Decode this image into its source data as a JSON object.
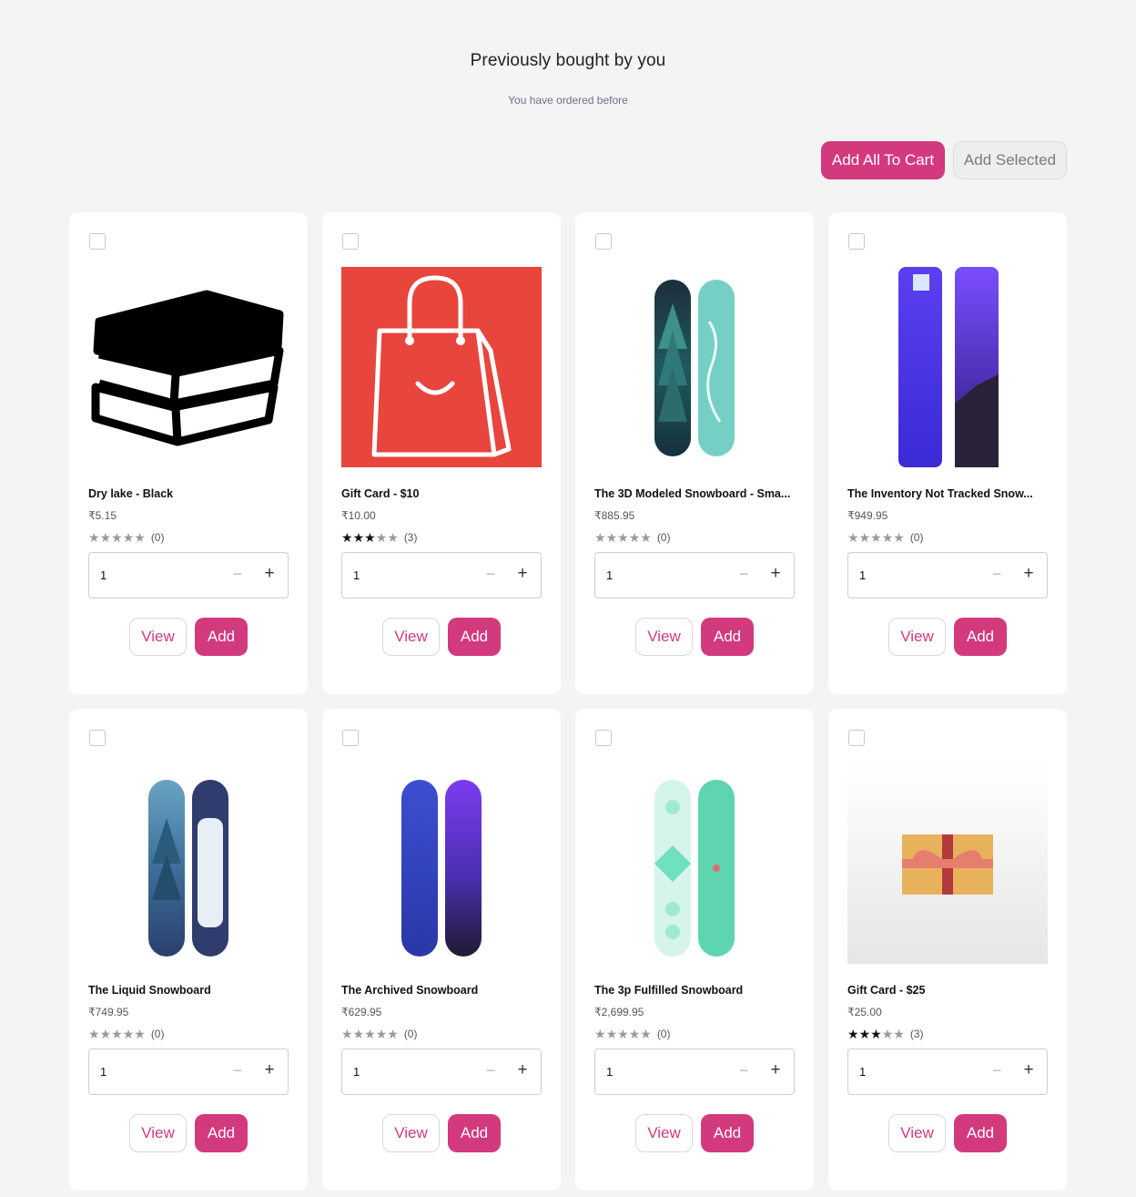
{
  "header": {
    "title": "Previously bought by you",
    "subtitle": "You have ordered before",
    "add_all_label": "Add All To Cart",
    "add_selected_label": "Add Selected"
  },
  "colors": {
    "accent": "#d23a7d",
    "background": "#f4f4f5",
    "gift_card_red": "#e8453c"
  },
  "products": [
    {
      "name": "Dry lake - Black",
      "price": "₹5.15",
      "rating": 0,
      "review_count": "(0)",
      "quantity": "1",
      "view_label": "View",
      "add_label": "Add",
      "image": "books-icon"
    },
    {
      "name": "Gift Card - $10",
      "price": "₹10.00",
      "rating": 3,
      "review_count": "(3)",
      "quantity": "1",
      "view_label": "View",
      "add_label": "Add",
      "image": "shopping-bag-icon"
    },
    {
      "name": "The 3D Modeled Snowboard - Sma...",
      "price": "₹885.95",
      "rating": 0,
      "review_count": "(0)",
      "quantity": "1",
      "view_label": "View",
      "add_label": "Add",
      "image": "snowboard-hydrogen"
    },
    {
      "name": "The Inventory Not Tracked Snow...",
      "price": "₹949.95",
      "rating": 0,
      "review_count": "(0)",
      "quantity": "1",
      "view_label": "View",
      "add_label": "Add",
      "image": "snowboard-purple"
    },
    {
      "name": "The Liquid Snowboard",
      "price": "₹749.95",
      "rating": 0,
      "review_count": "(0)",
      "quantity": "1",
      "view_label": "View",
      "add_label": "Add",
      "image": "snowboard-liquid"
    },
    {
      "name": "The Archived Snowboard",
      "price": "₹629.95",
      "rating": 0,
      "review_count": "(0)",
      "quantity": "1",
      "view_label": "View",
      "add_label": "Add",
      "image": "snowboard-archived"
    },
    {
      "name": "The 3p Fulfilled Snowboard",
      "price": "₹2,699.95",
      "rating": 0,
      "review_count": "(0)",
      "quantity": "1",
      "view_label": "View",
      "add_label": "Add",
      "image": "snowboard-mint"
    },
    {
      "name": "Gift Card - $25",
      "price": "₹25.00",
      "rating": 3,
      "review_count": "(3)",
      "quantity": "1",
      "view_label": "View",
      "add_label": "Add",
      "image": "gift-box"
    }
  ]
}
